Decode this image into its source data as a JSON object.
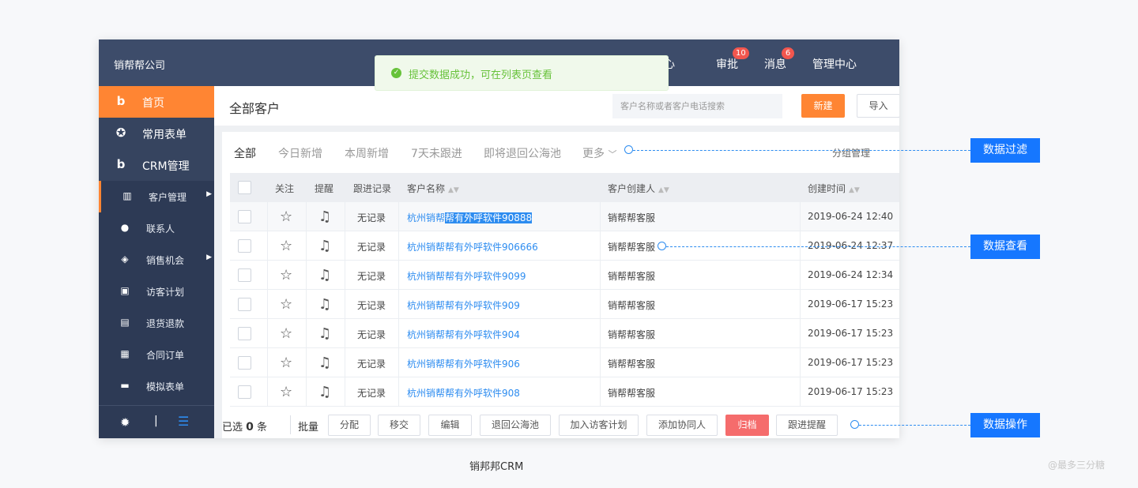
{
  "topbar": {
    "company": "销帮帮公司",
    "partial_icon_text": "心",
    "approve": "审批",
    "approve_badge": "10",
    "messages": "消息",
    "messages_badge": "6",
    "admin": "管理中心"
  },
  "toast": {
    "icon": "check-circle-icon",
    "text": "提交数据成功，可在列表页查看",
    "color": "#67c23a"
  },
  "sidebar": {
    "home": "首页",
    "common_forms": "常用表单",
    "crm": "CRM管理",
    "sub_items": [
      {
        "label": "客户管理",
        "icon": "building-icon"
      },
      {
        "label": "联系人",
        "icon": "person-icon"
      },
      {
        "label": "销售机会",
        "icon": "opportunity-icon"
      },
      {
        "label": "访客计划",
        "icon": "calendar-icon"
      },
      {
        "label": "退货退款",
        "icon": "clipboard-icon"
      },
      {
        "label": "合同订单",
        "icon": "document-icon"
      },
      {
        "label": "模拟表单",
        "icon": "printer-icon"
      }
    ],
    "footer_sep": "|",
    "accent": "#ff8533"
  },
  "header": {
    "title": "全部客户",
    "search_placeholder": "客户名称或者客户电话搜索",
    "new_button": "新建",
    "import_button": "导入"
  },
  "filters": {
    "tabs": [
      "全部",
      "今日新增",
      "本周新增",
      "7天未跟进",
      "即将退回公海池"
    ],
    "more": "更多",
    "group_mgmt": "分组管理"
  },
  "table": {
    "headers": {
      "follow": "关注",
      "remind": "提醒",
      "record": "跟进记录",
      "name": "客户名称",
      "creator": "客户创建人",
      "created": "创建时间"
    },
    "rows": [
      {
        "record": "无记录",
        "name_pre": "杭州销帮",
        "name_sel": "帮有外呼软件90888",
        "creator": "销帮帮客服",
        "created": "2019-06-24 12:40"
      },
      {
        "record": "无记录",
        "name": "杭州销帮帮有外呼软件906666",
        "creator": "销帮帮客服",
        "created": "2019-06-24 12:37"
      },
      {
        "record": "无记录",
        "name": "杭州销帮帮有外呼软件9099",
        "creator": "销帮帮客服",
        "created": "2019-06-24 12:34"
      },
      {
        "record": "无记录",
        "name": "杭州销帮帮有外呼软件909",
        "creator": "销帮帮客服",
        "created": "2019-06-17 15:23"
      },
      {
        "record": "无记录",
        "name": "杭州销帮帮有外呼软件904",
        "creator": "销帮帮客服",
        "created": "2019-06-17 15:23"
      },
      {
        "record": "无记录",
        "name": "杭州销帮帮有外呼软件906",
        "creator": "销帮帮客服",
        "created": "2019-06-17 15:23"
      },
      {
        "record": "无记录",
        "name": "杭州销帮帮有外呼软件908",
        "creator": "销帮帮客服",
        "created": "2019-06-17 15:23"
      }
    ]
  },
  "footer": {
    "selected_prefix": "已选",
    "selected_count": "0",
    "selected_suffix": "条",
    "batch": "批量",
    "buttons": [
      "分配",
      "移交",
      "编辑",
      "退回公海池",
      "加入访客计划",
      "添加协同人",
      "归档",
      "跟进提醒"
    ]
  },
  "annotations": {
    "filter": "数据过滤",
    "view": "数据查看",
    "operate": "数据操作",
    "color": "#1677ff"
  },
  "caption": "销邦邦CRM",
  "watermark": "@最多三分糖"
}
